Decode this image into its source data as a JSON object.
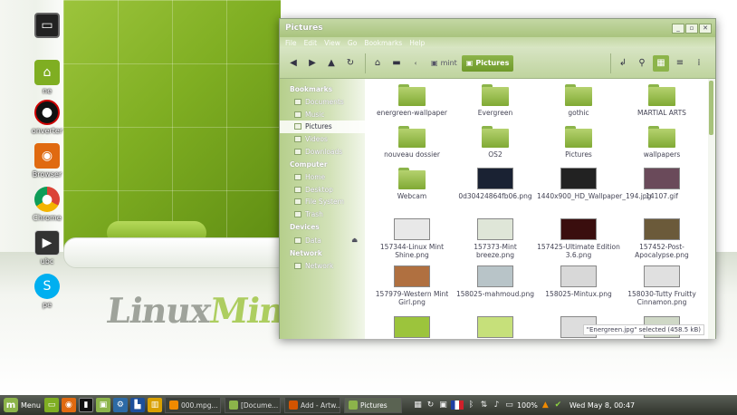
{
  "desktop": {
    "icons": [
      {
        "label": "",
        "icon": "monitor-icon"
      },
      {
        "label": "ne",
        "icon": "home-folder-icon"
      },
      {
        "label": "onverter",
        "icon": "converter-icon"
      },
      {
        "label": "Browser",
        "icon": "browser-icon"
      },
      {
        "label": "Chrome",
        "icon": "chrome-icon"
      },
      {
        "label": "ubc",
        "icon": "youtube-icon"
      },
      {
        "label": "pe",
        "icon": "skype-icon"
      }
    ],
    "logo_text": "Linux",
    "logo_text2": "Mint"
  },
  "window": {
    "title": "Pictures",
    "buttons": [
      "_",
      "▫",
      "✕"
    ],
    "menu": [
      "File",
      "Edit",
      "View",
      "Go",
      "Bookmarks",
      "Help"
    ],
    "breadcrumbs": [
      "mint",
      "Pictures"
    ],
    "status": "\"Energreen.jpg\" selected (458.5 kB)"
  },
  "sidebar": {
    "bookmarks_heading": "Bookmarks",
    "bookmarks": [
      "Documents",
      "Music",
      "Pictures",
      "Videos",
      "Downloads"
    ],
    "computer_heading": "Computer",
    "computer": [
      "Home",
      "Desktop",
      "File System",
      "Trash"
    ],
    "devices_heading": "Devices",
    "devices": [
      "Data"
    ],
    "network_heading": "Network",
    "network": [
      "Network"
    ]
  },
  "files": [
    {
      "name": "energreen-wallpaper",
      "type": "folder"
    },
    {
      "name": "Evergreen",
      "type": "folder"
    },
    {
      "name": "gothic",
      "type": "folder"
    },
    {
      "name": "MARTIAL ARTS",
      "type": "folder"
    },
    {
      "name": "nouveau dossier",
      "type": "folder"
    },
    {
      "name": "OS2",
      "type": "folder"
    },
    {
      "name": "Pictures",
      "type": "folder"
    },
    {
      "name": "wallpapers",
      "type": "folder"
    },
    {
      "name": "Webcam",
      "type": "folder"
    },
    {
      "name": "0d30424864fb06.png",
      "type": "image",
      "color": "#1a2233"
    },
    {
      "name": "1440x900_HD_Wallpaper_194.jpg",
      "type": "image",
      "color": "#222"
    },
    {
      "name": "14107.gif",
      "type": "image",
      "color": "#6a4a5a"
    },
    {
      "name": "157344-Linux Mint Shine.png",
      "type": "image",
      "color": "#e8e8e8"
    },
    {
      "name": "157373-Mint breeze.png",
      "type": "image",
      "color": "#dfe6d8"
    },
    {
      "name": "157425-Ultimate Edition 3.6.png",
      "type": "image",
      "color": "#3a0e0e"
    },
    {
      "name": "157452-Post-Apocalypse.png",
      "type": "image",
      "color": "#6b5a3a"
    },
    {
      "name": "157979-Western Mint Girl.png",
      "type": "image",
      "color": "#b07040"
    },
    {
      "name": "158025-mahmoud.png",
      "type": "image",
      "color": "#b8c4c8"
    },
    {
      "name": "158025-Mintux.png",
      "type": "image",
      "color": "#d8d8d8"
    },
    {
      "name": "158030-Tutty Fruitty Cinnamon.png",
      "type": "image",
      "color": "#e0e0e0"
    },
    {
      "name": "",
      "type": "image",
      "color": "#9cc43c"
    },
    {
      "name": "",
      "type": "image",
      "color": "#c6e07a"
    },
    {
      "name": "",
      "type": "image",
      "color": "#ddd"
    },
    {
      "name": "",
      "type": "image",
      "color": "#cfd8c6"
    }
  ],
  "taskbar": {
    "menu_label": "Menu",
    "tasks": [
      {
        "label": "000.mpg...",
        "icon": "vlc-icon",
        "color": "#f08a00"
      },
      {
        "label": "[Docume...",
        "icon": "folder-icon",
        "color": "#8cb44a"
      },
      {
        "label": "Add - Artw...",
        "icon": "firefox-icon",
        "color": "#d35400"
      },
      {
        "label": "Pictures",
        "icon": "folder-icon",
        "color": "#8cb44a"
      }
    ],
    "battery": "100%",
    "clock": "Wed May  8, 00:47"
  }
}
